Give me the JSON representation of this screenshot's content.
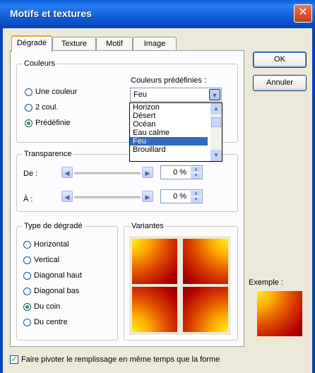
{
  "window": {
    "title": "Motifs et textures",
    "close_glyph": "✕"
  },
  "tabs": [
    {
      "label": "Dégradé",
      "active": true
    },
    {
      "label": "Texture",
      "active": false
    },
    {
      "label": "Motif",
      "active": false
    },
    {
      "label": "Image",
      "active": false
    }
  ],
  "couleurs": {
    "title": "Couleurs",
    "options": [
      "Une couleur",
      "2 coul.",
      "Prédéfinie"
    ],
    "selected": 2
  },
  "preset": {
    "label": "Couleurs prédéfinies :",
    "value": "Feu",
    "list": [
      "Horizon",
      "Désert",
      "Océan",
      "Eau calme",
      "Feu",
      "Brouillard"
    ],
    "selected": 4
  },
  "transparence": {
    "title": "Transparence",
    "de_label": "De :",
    "a_label": "À :",
    "de_value": "0 %",
    "a_value": "0 %"
  },
  "shading": {
    "title": "Type de dégradé",
    "options": [
      "Horizontal",
      "Vertical",
      "Diagonal haut",
      "Diagonal bas",
      "Du coin",
      "Du centre"
    ],
    "selected": 4
  },
  "variants": {
    "title": "Variantes"
  },
  "buttons": {
    "ok": "OK",
    "cancel": "Annuler"
  },
  "sample": {
    "label": "Exemple :"
  },
  "rotate_checkbox": {
    "label": "Faire pivoter le remplissage en même temps que la forme",
    "checked": true
  }
}
